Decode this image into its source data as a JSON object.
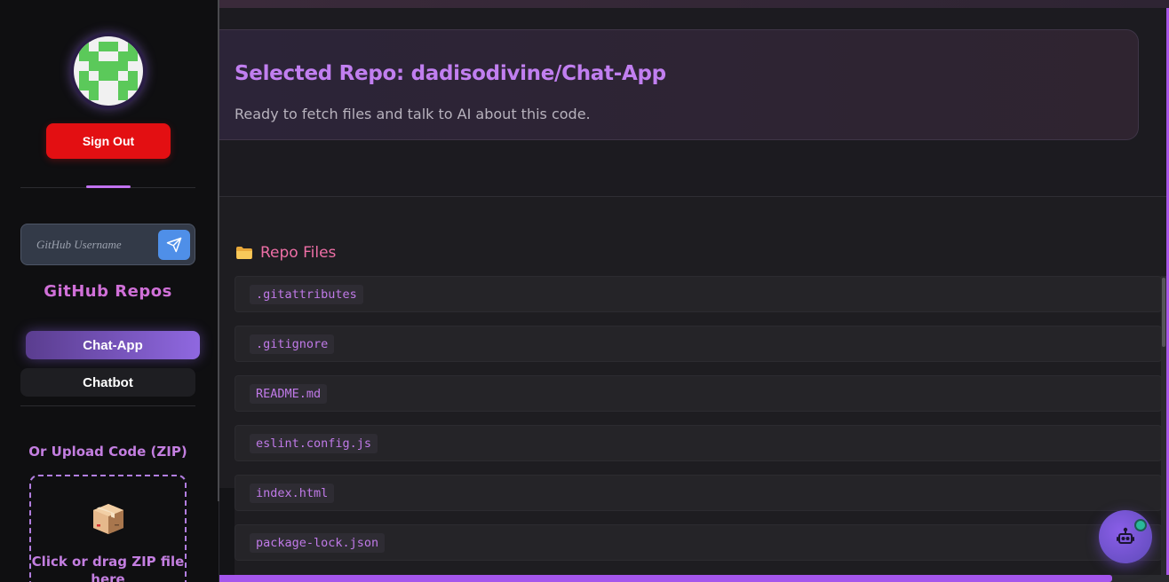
{
  "sidebar": {
    "avatar_icon": "identicon-avatar",
    "signout_label": "Sign Out",
    "search": {
      "placeholder": "GitHub Username",
      "value": "",
      "send_icon": "send-icon"
    },
    "repos_title": "GitHub Repos",
    "repos": [
      {
        "label": "Chat-App",
        "active": true
      },
      {
        "label": "Chatbot",
        "active": false
      }
    ],
    "upload": {
      "title": "Or Upload Code (ZIP)",
      "icon": "package-icon",
      "text": "Click or drag ZIP file here"
    }
  },
  "main": {
    "repo_card": {
      "title": "Selected Repo: dadisodivine/Chat-App",
      "subtitle": "Ready to fetch files and talk to AI about this code."
    },
    "files": {
      "icon": "folder-icon",
      "title": "Repo Files",
      "items": [
        ".gitattributes",
        ".gitignore",
        "README.md",
        "eslint.config.js",
        "index.html",
        "package-lock.json"
      ]
    },
    "progress": 0.94,
    "ai_button_icon": "robot-icon"
  },
  "colors": {
    "accent": "#c17ff0",
    "signout": "#e30f12",
    "active_repo_start": "#5a3d8f",
    "active_repo_end": "#8f68e0",
    "file_title": "#ee6fa6"
  }
}
